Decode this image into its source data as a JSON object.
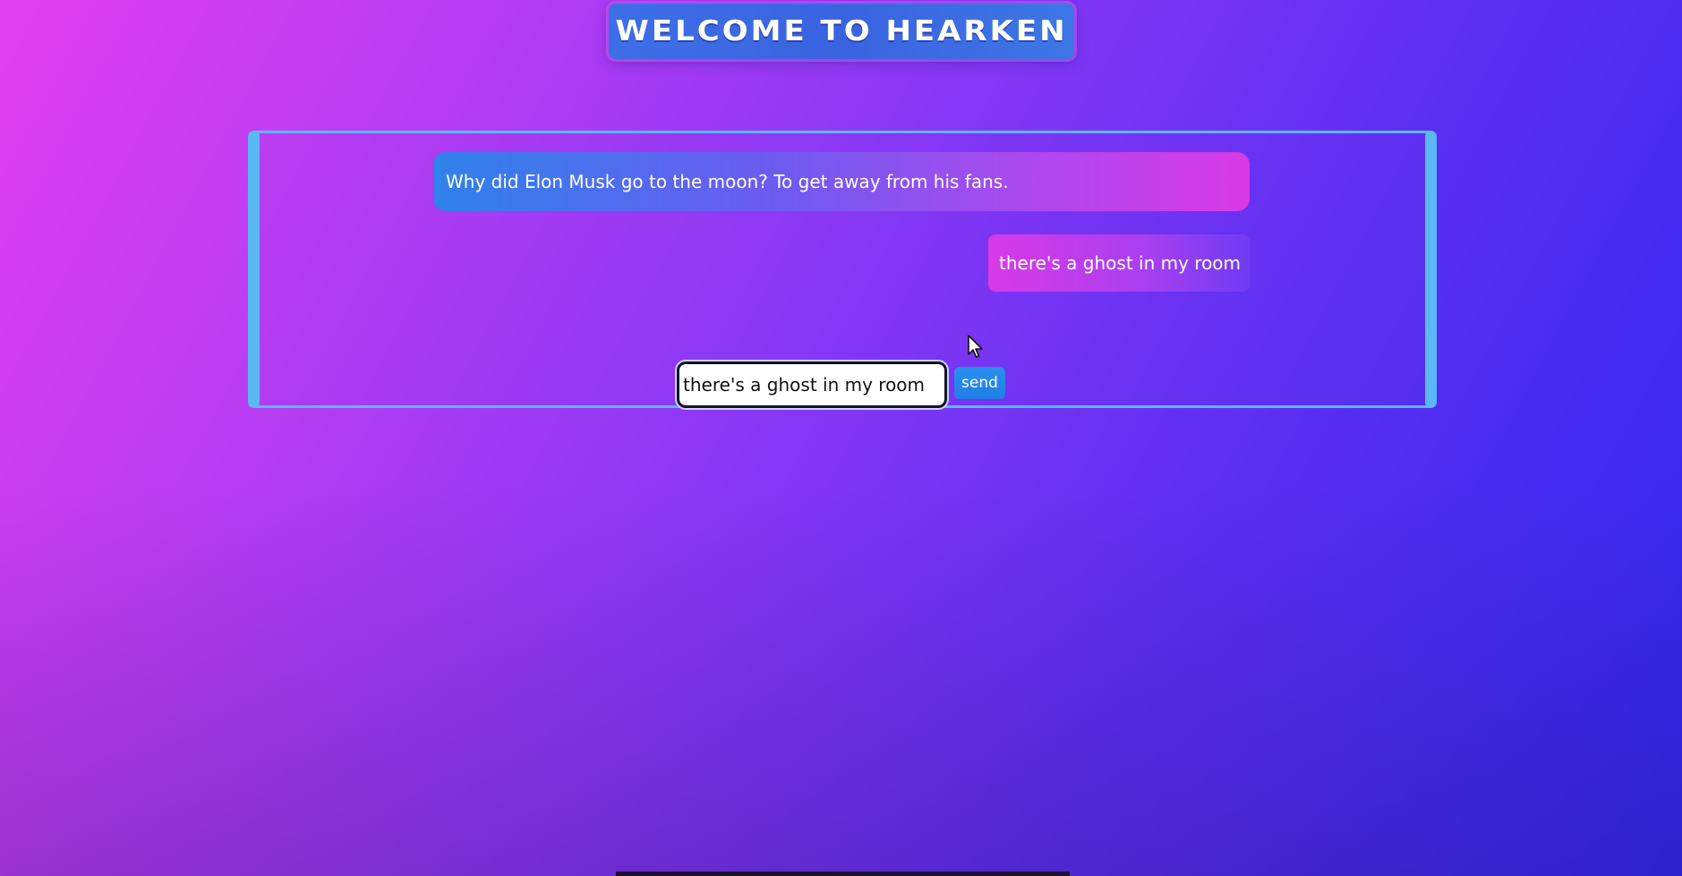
{
  "header": {
    "title": "WELCOME TO HEARKEN"
  },
  "chat": {
    "messages": [
      {
        "sender": "bot",
        "text": "Why did Elon Musk go to the moon? To get away from his fans."
      },
      {
        "sender": "user",
        "text": "there's a ghost in my room"
      }
    ]
  },
  "composer": {
    "input_value": "there's a ghost in my room",
    "send_label": "send"
  },
  "colors": {
    "accent": "#5ab8f4",
    "send_button": "#2a8fee",
    "title_banner": "#3d6fe8"
  },
  "icons": {
    "pointer": "mouse-pointer-icon"
  }
}
